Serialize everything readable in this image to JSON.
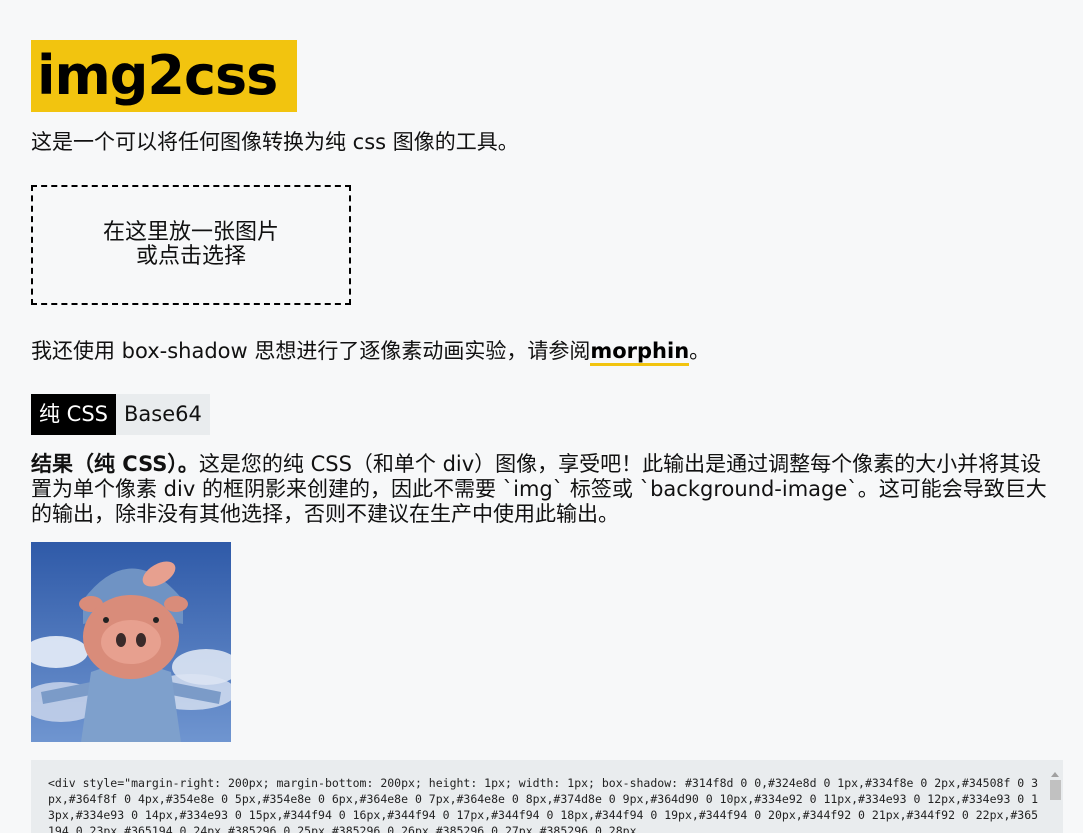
{
  "header": {
    "logo_text": "img2css",
    "tagline": "这是一个可以将任何图像转换为纯 css 图像的工具。"
  },
  "dropzone": {
    "line1": "在这里放一张图片",
    "line2": "或点击选择"
  },
  "experiment": {
    "prefix": "我还使用 box-shadow 思想进行了逐像素动画实验，请参阅",
    "link_label": "morphin",
    "suffix": "。"
  },
  "tabs": [
    {
      "label": "纯 CSS",
      "active": true
    },
    {
      "label": "Base64",
      "active": false
    }
  ],
  "result": {
    "heading": "结果（纯 CSS）。",
    "description": "这是您的纯 CSS（和单个 div）图像，享受吧！此输出是通过调整每个像素的大小并将其设置为单个像素 div 的框阴影来创建的，因此不需要 `img` 标签或 `background-image`。这可能会导致巨大的输出，除非没有其他选择，否则不建议在生产中使用此输出。"
  },
  "preview": {
    "alt": "pig plush image",
    "colors": {
      "sky": "#3a6fbf",
      "hat": "#6f93c4",
      "face": "#d98c7a",
      "snout": "#e7a08f",
      "body": "#7ea0cc"
    }
  },
  "code": {
    "text": "<div style=\"margin-right: 200px; margin-bottom: 200px; height: 1px; width: 1px; box-shadow: #314f8d 0 0,#324e8d 0 1px,#334f8e 0 2px,#34508f 0 3px,#364f8f 0 4px,#354e8e 0 5px,#354e8e 0 6px,#364e8e 0 7px,#364e8e 0 8px,#374d8e 0 9px,#364d90 0 10px,#334e92 0 11px,#334e93 0 12px,#334e93 0 13px,#334e93 0 14px,#334e93 0 15px,#344f94 0 16px,#344f94 0 17px,#344f94 0 18px,#344f94 0 19px,#344f94 0 20px,#344f92 0 21px,#344f92 0 22px,#365194 0 23px,#365194 0 24px,#385296 0 25px,#385296 0 26px,#385296 0 27px,#385296 0 28px"
  }
}
